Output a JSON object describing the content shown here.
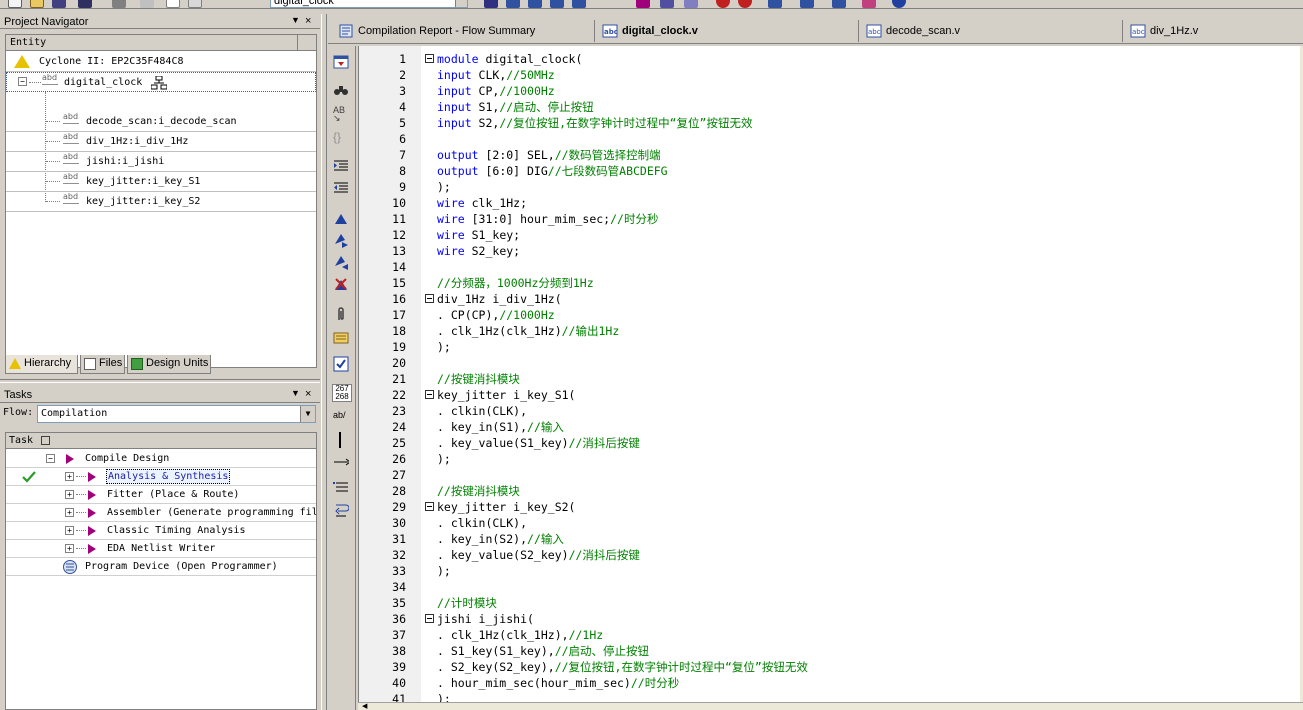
{
  "toolbar": {
    "project_combo_value": "digital_clock"
  },
  "project_navigator": {
    "title": "Project Navigator",
    "controls": [
      "▼",
      "×"
    ],
    "column_header": "Entity",
    "device": "Cyclone II: EP2C35F484C8",
    "top_entity": "digital_clock",
    "children": [
      "decode_scan:i_decode_scan",
      "div_1Hz:i_div_1Hz",
      "jishi:i_jishi",
      "key_jitter:i_key_S1",
      "key_jitter:i_key_S2"
    ],
    "tabs": [
      "Hierarchy",
      "Files",
      "Design Units"
    ]
  },
  "tasks": {
    "title": "Tasks",
    "controls": [
      "▼",
      "×"
    ],
    "flow_label": "Flow:",
    "flow_value": "Compilation",
    "column_header": "Task",
    "rows": [
      {
        "label": "Compile Design",
        "level": 0,
        "status": ""
      },
      {
        "label": "Analysis & Synthesis",
        "level": 1,
        "status": "done",
        "highlight": true
      },
      {
        "label": "Fitter (Place & Route)",
        "level": 1,
        "status": ""
      },
      {
        "label": "Assembler (Generate programming fil",
        "level": 1,
        "status": ""
      },
      {
        "label": "Classic Timing Analysis",
        "level": 1,
        "status": ""
      },
      {
        "label": "EDA Netlist Writer",
        "level": 1,
        "status": ""
      },
      {
        "label": "Program Device (Open Programmer)",
        "level": 0,
        "status": ""
      }
    ]
  },
  "editor_tabs": [
    {
      "label": "Compilation Report - Flow Summary",
      "active": false
    },
    {
      "label": "digital_clock.v",
      "active": true
    },
    {
      "label": "decode_scan.v",
      "active": false
    },
    {
      "label": "div_1Hz.v",
      "active": false
    }
  ],
  "side_tools": {
    "line_count_label_top": "267",
    "line_count_label_bottom": "268",
    "ab_label": "ab/"
  },
  "code": {
    "lines": [
      {
        "n": "1",
        "fold": true,
        "parts": [
          [
            "kw",
            "module"
          ],
          [
            "t",
            " digital_clock("
          ]
        ]
      },
      {
        "n": "2",
        "fold": false,
        "parts": [
          [
            "kw",
            "input"
          ],
          [
            "t",
            " CLK,"
          ],
          [
            "cm",
            "//50MHz"
          ]
        ]
      },
      {
        "n": "3",
        "fold": false,
        "parts": [
          [
            "kw",
            "input"
          ],
          [
            "t",
            " CP,"
          ],
          [
            "cm",
            "//1000Hz"
          ]
        ]
      },
      {
        "n": "4",
        "fold": false,
        "parts": [
          [
            "kw",
            "input"
          ],
          [
            "t",
            " S1,"
          ],
          [
            "cm",
            "//启动、停止按钮"
          ]
        ]
      },
      {
        "n": "5",
        "fold": false,
        "parts": [
          [
            "kw",
            "input"
          ],
          [
            "t",
            " S2,"
          ],
          [
            "cm",
            "//复位按钮,在数字钟计时过程中“复位”按钮无效"
          ]
        ]
      },
      {
        "n": "6",
        "fold": false,
        "parts": []
      },
      {
        "n": "7",
        "fold": false,
        "parts": [
          [
            "kw",
            "output"
          ],
          [
            "t",
            " [2:0] SEL,"
          ],
          [
            "cm",
            "//数码管选择控制端"
          ]
        ]
      },
      {
        "n": "8",
        "fold": false,
        "parts": [
          [
            "kw",
            "output"
          ],
          [
            "t",
            " [6:0] DIG"
          ],
          [
            "cm",
            "//七段数码管ABCDEFG"
          ]
        ]
      },
      {
        "n": "9",
        "fold": false,
        "parts": [
          [
            "t",
            ");"
          ]
        ]
      },
      {
        "n": "10",
        "fold": false,
        "parts": [
          [
            "kw",
            "wire"
          ],
          [
            "t",
            " clk_1Hz;"
          ]
        ]
      },
      {
        "n": "11",
        "fold": false,
        "parts": [
          [
            "kw",
            "wire"
          ],
          [
            "t",
            " [31:0] hour_mim_sec;"
          ],
          [
            "cm",
            "//时分秒"
          ]
        ]
      },
      {
        "n": "12",
        "fold": false,
        "parts": [
          [
            "kw",
            "wire"
          ],
          [
            "t",
            " S1_key;"
          ]
        ]
      },
      {
        "n": "13",
        "fold": false,
        "parts": [
          [
            "kw",
            "wire"
          ],
          [
            "t",
            " S2_key;"
          ]
        ]
      },
      {
        "n": "14",
        "fold": false,
        "parts": []
      },
      {
        "n": "15",
        "fold": false,
        "parts": [
          [
            "cm",
            "//分频器，1000Hz分频到1Hz"
          ]
        ]
      },
      {
        "n": "16",
        "fold": true,
        "parts": [
          [
            "t",
            "div_1Hz i_div_1Hz("
          ]
        ]
      },
      {
        "n": "17",
        "fold": false,
        "parts": [
          [
            "t",
            ". CP(CP),"
          ],
          [
            "cm",
            "//1000Hz"
          ]
        ]
      },
      {
        "n": "18",
        "fold": false,
        "parts": [
          [
            "t",
            ". clk_1Hz(clk_1Hz)"
          ],
          [
            "cm",
            "//输出1Hz"
          ]
        ]
      },
      {
        "n": "19",
        "fold": false,
        "parts": [
          [
            "t",
            ");"
          ]
        ]
      },
      {
        "n": "20",
        "fold": false,
        "parts": []
      },
      {
        "n": "21",
        "fold": false,
        "parts": [
          [
            "cm",
            "//按键消抖模块"
          ]
        ]
      },
      {
        "n": "22",
        "fold": true,
        "parts": [
          [
            "t",
            "key_jitter i_key_S1("
          ]
        ]
      },
      {
        "n": "23",
        "fold": false,
        "parts": [
          [
            "t",
            ". clkin(CLK),"
          ]
        ]
      },
      {
        "n": "24",
        "fold": false,
        "parts": [
          [
            "t",
            ". key_in(S1),"
          ],
          [
            "cm",
            "//输入"
          ]
        ]
      },
      {
        "n": "25",
        "fold": false,
        "parts": [
          [
            "t",
            ". key_value(S1_key)"
          ],
          [
            "cm",
            "//消抖后按键"
          ]
        ]
      },
      {
        "n": "26",
        "fold": false,
        "parts": [
          [
            "t",
            ");"
          ]
        ]
      },
      {
        "n": "27",
        "fold": false,
        "parts": []
      },
      {
        "n": "28",
        "fold": false,
        "parts": [
          [
            "cm",
            "//按键消抖模块"
          ]
        ]
      },
      {
        "n": "29",
        "fold": true,
        "parts": [
          [
            "t",
            "key_jitter i_key_S2("
          ]
        ]
      },
      {
        "n": "30",
        "fold": false,
        "parts": [
          [
            "t",
            ". clkin(CLK),"
          ]
        ]
      },
      {
        "n": "31",
        "fold": false,
        "parts": [
          [
            "t",
            ". key_in(S2),"
          ],
          [
            "cm",
            "//输入"
          ]
        ]
      },
      {
        "n": "32",
        "fold": false,
        "parts": [
          [
            "t",
            ". key_value(S2_key)"
          ],
          [
            "cm",
            "//消抖后按键"
          ]
        ]
      },
      {
        "n": "33",
        "fold": false,
        "parts": [
          [
            "t",
            ");"
          ]
        ]
      },
      {
        "n": "34",
        "fold": false,
        "parts": []
      },
      {
        "n": "35",
        "fold": false,
        "parts": [
          [
            "cm",
            "//计时模块"
          ]
        ]
      },
      {
        "n": "36",
        "fold": true,
        "parts": [
          [
            "t",
            "jishi i_jishi("
          ]
        ]
      },
      {
        "n": "37",
        "fold": false,
        "parts": [
          [
            "t",
            ". clk_1Hz(clk_1Hz),"
          ],
          [
            "cm",
            "//1Hz"
          ]
        ]
      },
      {
        "n": "38",
        "fold": false,
        "parts": [
          [
            "t",
            ". S1_key(S1_key),"
          ],
          [
            "cm",
            "//启动、停止按钮"
          ]
        ]
      },
      {
        "n": "39",
        "fold": false,
        "parts": [
          [
            "t",
            ". S2_key(S2_key),"
          ],
          [
            "cm",
            "//复位按钮,在数字钟计时过程中“复位”按钮无效"
          ]
        ]
      },
      {
        "n": "40",
        "fold": false,
        "parts": [
          [
            "t",
            ". hour_mim_sec(hour_mim_sec)"
          ],
          [
            "cm",
            "//时分秒"
          ]
        ]
      },
      {
        "n": "41",
        "fold": false,
        "parts": [
          [
            "t",
            ");"
          ]
        ]
      }
    ]
  },
  "colors": {
    "keyword": "#0000ff",
    "comment": "#008000",
    "task_play": "#a0007c",
    "check": "#2a9a2a",
    "warning": "#e6c200"
  }
}
